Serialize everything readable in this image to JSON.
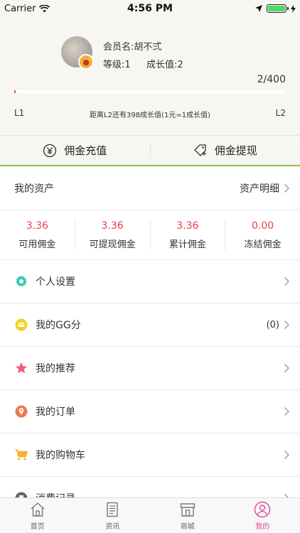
{
  "status_bar": {
    "carrier": "Carrier",
    "time": "4:56 PM"
  },
  "profile": {
    "member_name": "会员名:胡不弍",
    "level": "等级:1",
    "growth": "成长值:2",
    "progress_text": "2/400",
    "progress_fraction": 0.005,
    "level_from": "L1",
    "level_to": "L2",
    "level_hint": "距离L2还有398成长值(1元=1成长值)"
  },
  "actions": {
    "recharge": "佣金充值",
    "withdraw": "佣金提现"
  },
  "assets": {
    "title": "我的资产",
    "detail": "资产明细",
    "items": [
      {
        "value": "3.36",
        "label": "可用佣金"
      },
      {
        "value": "3.36",
        "label": "可提现佣金"
      },
      {
        "value": "3.36",
        "label": "累计佣金"
      },
      {
        "value": "0.00",
        "label": "冻结佣金"
      }
    ]
  },
  "menu": {
    "items": [
      {
        "label": "个人设置",
        "icon": "gear-icon",
        "color": "#3cc6b0",
        "extra": ""
      },
      {
        "label": "我的GG分",
        "icon": "points-icon",
        "color": "#f2d21a",
        "extra": "(0)"
      },
      {
        "label": "我的推荐",
        "icon": "star-icon",
        "color": "#ef5f78",
        "extra": ""
      },
      {
        "label": "我的订单",
        "icon": "location-pin-icon",
        "color": "#f07a50",
        "extra": ""
      },
      {
        "label": "我的购物车",
        "icon": "cart-icon",
        "color": "#f2b233",
        "extra": ""
      },
      {
        "label": "消费记录",
        "icon": "record-icon",
        "color": "#666666",
        "extra": ""
      }
    ]
  },
  "tabbar": {
    "items": [
      {
        "label": "首页",
        "icon": "home-icon",
        "active": false
      },
      {
        "label": "资讯",
        "icon": "news-icon",
        "active": false
      },
      {
        "label": "商城",
        "icon": "store-icon",
        "active": false
      },
      {
        "label": "我的",
        "icon": "profile-icon",
        "active": true
      }
    ]
  },
  "colors": {
    "accent": "#e0479a",
    "progress": "#e43c3c",
    "asset_value": "#e8424a",
    "divider_green": "#8bc34a"
  }
}
